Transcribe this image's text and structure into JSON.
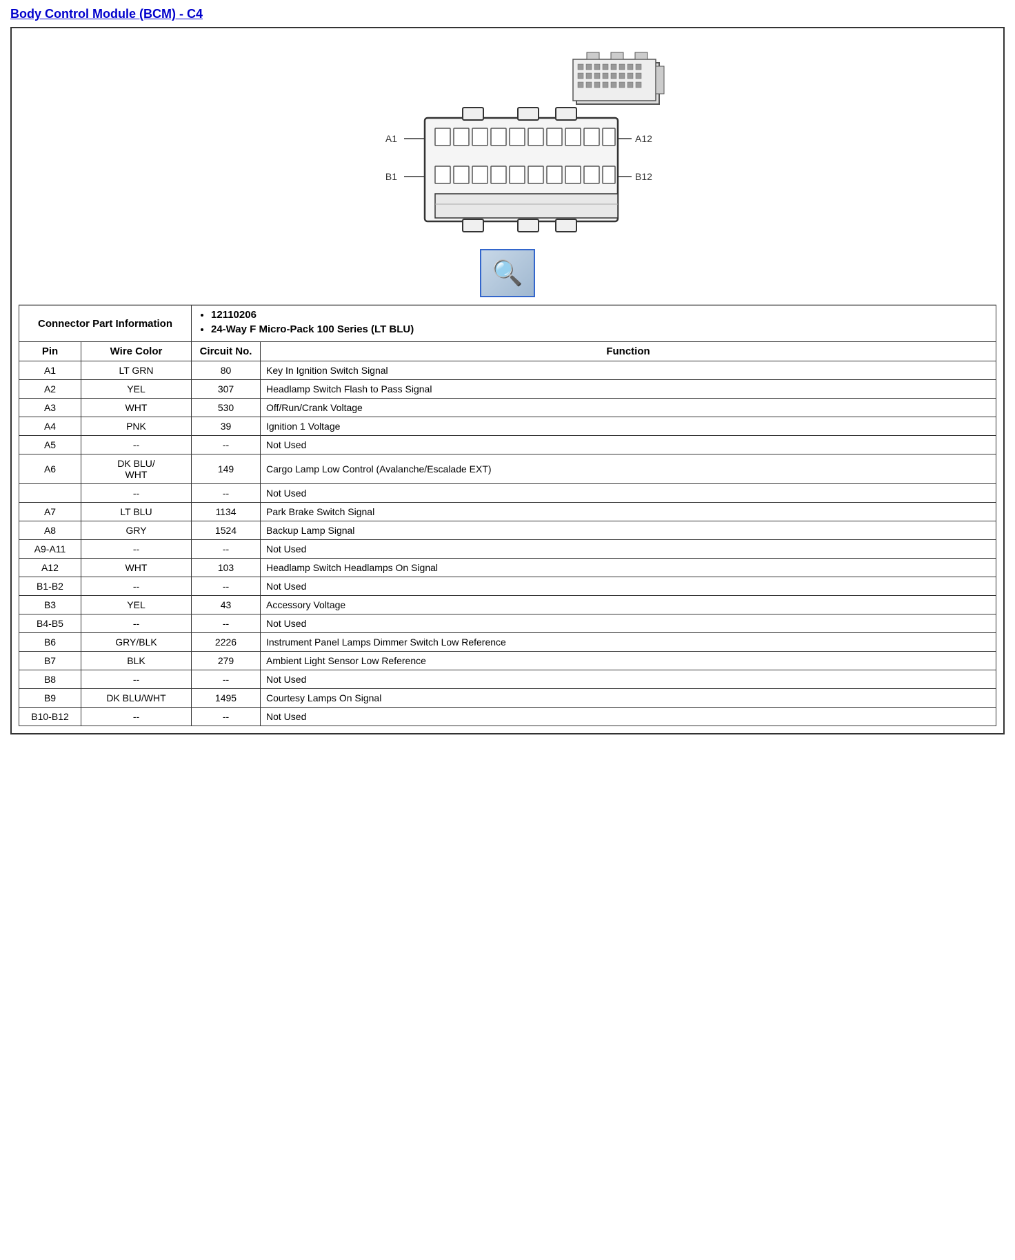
{
  "title": "Body Control Module (BCM) - C4",
  "connector_info": {
    "label": "Connector Part Information",
    "part_number": "12110206",
    "description": "24-Way F Micro-Pack 100 Series (LT BLU)"
  },
  "table_headers": {
    "pin": "Pin",
    "wire_color": "Wire Color",
    "circuit_no": "Circuit No.",
    "function": "Function"
  },
  "rows": [
    {
      "pin": "A1",
      "wire_color": "LT GRN",
      "circuit_no": "80",
      "function": "Key In Ignition Switch Signal"
    },
    {
      "pin": "A2",
      "wire_color": "YEL",
      "circuit_no": "307",
      "function": "Headlamp Switch Flash to Pass Signal"
    },
    {
      "pin": "A3",
      "wire_color": "WHT",
      "circuit_no": "530",
      "function": "Off/Run/Crank Voltage"
    },
    {
      "pin": "A4",
      "wire_color": "PNK",
      "circuit_no": "39",
      "function": "Ignition 1 Voltage"
    },
    {
      "pin": "A5",
      "wire_color": "--",
      "circuit_no": "--",
      "function": "Not Used"
    },
    {
      "pin": "A6",
      "wire_color": "DK BLU/\nWHT",
      "circuit_no": "149",
      "function": "Cargo Lamp Low Control (Avalanche/Escalade EXT)"
    },
    {
      "pin": "",
      "wire_color": "--",
      "circuit_no": "--",
      "function": "Not Used"
    },
    {
      "pin": "A7",
      "wire_color": "LT BLU",
      "circuit_no": "1134",
      "function": "Park Brake Switch Signal"
    },
    {
      "pin": "A8",
      "wire_color": "GRY",
      "circuit_no": "1524",
      "function": "Backup Lamp Signal"
    },
    {
      "pin": "A9-A11",
      "wire_color": "--",
      "circuit_no": "--",
      "function": "Not Used"
    },
    {
      "pin": "A12",
      "wire_color": "WHT",
      "circuit_no": "103",
      "function": "Headlamp Switch Headlamps On Signal"
    },
    {
      "pin": "B1-B2",
      "wire_color": "--",
      "circuit_no": "--",
      "function": "Not Used"
    },
    {
      "pin": "B3",
      "wire_color": "YEL",
      "circuit_no": "43",
      "function": "Accessory Voltage"
    },
    {
      "pin": "B4-B5",
      "wire_color": "--",
      "circuit_no": "--",
      "function": "Not Used"
    },
    {
      "pin": "B6",
      "wire_color": "GRY/BLK",
      "circuit_no": "2226",
      "function": "Instrument Panel Lamps Dimmer Switch Low Reference"
    },
    {
      "pin": "B7",
      "wire_color": "BLK",
      "circuit_no": "279",
      "function": "Ambient Light Sensor Low Reference"
    },
    {
      "pin": "B8",
      "wire_color": "--",
      "circuit_no": "--",
      "function": "Not Used"
    },
    {
      "pin": "B9",
      "wire_color": "DK BLU/WHT",
      "circuit_no": "1495",
      "function": "Courtesy Lamps On Signal"
    },
    {
      "pin": "B10-B12",
      "wire_color": "--",
      "circuit_no": "--",
      "function": "Not Used"
    }
  ]
}
